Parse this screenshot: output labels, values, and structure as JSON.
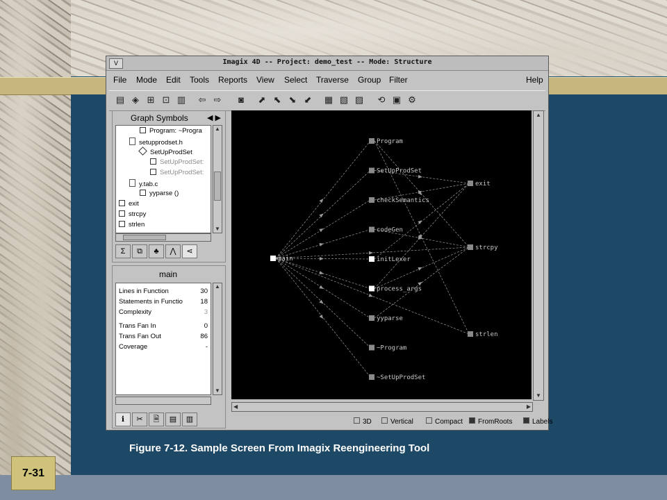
{
  "slide": {
    "caption": "Figure 7-12. Sample Screen From Imagix Reengineering Tool",
    "page_tag": "7-31"
  },
  "window": {
    "title": "Imagix 4D -- Project: demo_test -- Mode: Structure",
    "button_glyph": "V"
  },
  "menubar": {
    "items": [
      {
        "label": "File",
        "u": "F"
      },
      {
        "label": "Mode",
        "u": "M"
      },
      {
        "label": "Edit",
        "u": "E"
      },
      {
        "label": "Tools",
        "u": "T"
      },
      {
        "label": "Reports",
        "u": "R"
      },
      {
        "label": "View",
        "u": "V"
      },
      {
        "label": "Select",
        "u": "S"
      },
      {
        "label": "Traverse",
        "u": "T"
      },
      {
        "label": "Group",
        "u": "G"
      },
      {
        "label": "Filter",
        "u": "F"
      },
      {
        "label": "Help",
        "u": "H"
      }
    ]
  },
  "toolbar": {
    "icons": [
      "▤",
      "◈",
      "⊞",
      "⊡",
      "▥",
      "⇦",
      "⇨",
      "◙",
      "⬈",
      "⬉",
      "⬊",
      "⬋",
      "▦",
      "▧",
      "▨",
      "⟲",
      "▣",
      "⚙"
    ]
  },
  "graph_symbols": {
    "title": "Graph Symbols",
    "arrow_left": "◀",
    "arrow_right": "▶",
    "tree": [
      {
        "text": "Program: ~Progra",
        "type": "box",
        "indent": 2,
        "dim": false
      },
      {
        "text": "setupprodset.h",
        "type": "file",
        "indent": 1,
        "dim": false
      },
      {
        "text": "SetUpProdSet",
        "type": "diamond",
        "indent": 2,
        "dim": false
      },
      {
        "text": "SetUpProdSet:",
        "type": "box",
        "indent": 3,
        "dim": true
      },
      {
        "text": "SetUpProdSet:",
        "type": "box",
        "indent": 3,
        "dim": true
      },
      {
        "text": "y.tab.c",
        "type": "file",
        "indent": 1,
        "dim": false
      },
      {
        "text": "yyparse ()",
        "type": "box",
        "indent": 2,
        "dim": false
      },
      {
        "text": "exit",
        "type": "box",
        "indent": 0,
        "dim": false
      },
      {
        "text": "strcpy",
        "type": "box",
        "indent": 0,
        "dim": false
      },
      {
        "text": "strlen",
        "type": "box",
        "indent": 0,
        "dim": false
      }
    ],
    "tabs": [
      "Σ",
      "⧉",
      "♣",
      "⋀",
      "⋖"
    ]
  },
  "main_panel": {
    "title": "main",
    "stats": [
      {
        "label": "Lines in Function",
        "value": "30",
        "dim": false
      },
      {
        "label": "Statements in Functio",
        "value": "18",
        "dim": false
      },
      {
        "label": "Complexity",
        "value": "3",
        "dim": true
      },
      {
        "label": "Trans Fan In",
        "value": "0",
        "dim": false
      },
      {
        "label": "Trans Fan Out",
        "value": "86",
        "dim": false
      },
      {
        "label": "Coverage",
        "value": "-",
        "dim": false
      }
    ],
    "tabs": [
      "ℹ",
      "✂",
      "🗎",
      "▤",
      "▥"
    ]
  },
  "graph": {
    "source": {
      "label": "main"
    },
    "middle": [
      {
        "label": "Program"
      },
      {
        "label": "SetUpProdSet"
      },
      {
        "label": "checkSemantics"
      },
      {
        "label": "codeGen"
      },
      {
        "label": "initLexer"
      },
      {
        "label": "process_args"
      },
      {
        "label": "yyparse"
      },
      {
        "label": "~Program"
      },
      {
        "label": "~SetUpProdSet"
      }
    ],
    "right": [
      {
        "label": "exit"
      },
      {
        "label": "strcpy"
      },
      {
        "label": "strlen"
      }
    ],
    "cross_edges": [
      {
        "from": "Program",
        "to": "strcpy"
      },
      {
        "from": "Program",
        "to": "strlen"
      },
      {
        "from": "SetUpProdSet",
        "to": "exit"
      },
      {
        "from": "checkSemantics",
        "to": "exit"
      },
      {
        "from": "codeGen",
        "to": "strcpy"
      },
      {
        "from": "initLexer",
        "to": "exit"
      },
      {
        "from": "process_args",
        "to": "exit"
      },
      {
        "from": "process_args",
        "to": "strcpy"
      },
      {
        "from": "yyparse",
        "to": "strcpy"
      },
      {
        "from": "main",
        "to": "strlen"
      },
      {
        "from": "main",
        "to": "strcpy"
      }
    ]
  },
  "options": [
    {
      "label": "3D",
      "checked": false
    },
    {
      "label": "Vertical",
      "checked": false
    },
    {
      "label": "Compact",
      "checked": false
    },
    {
      "label": "FromRoots",
      "checked": true
    },
    {
      "label": "Labels",
      "checked": true
    }
  ],
  "colors": {
    "slide_blue": "#1d4866",
    "band_gold": "#c6b77f",
    "window_gray": "#c3c3c3",
    "graph_bg": "#000000",
    "edge": "#9a9a9a"
  }
}
